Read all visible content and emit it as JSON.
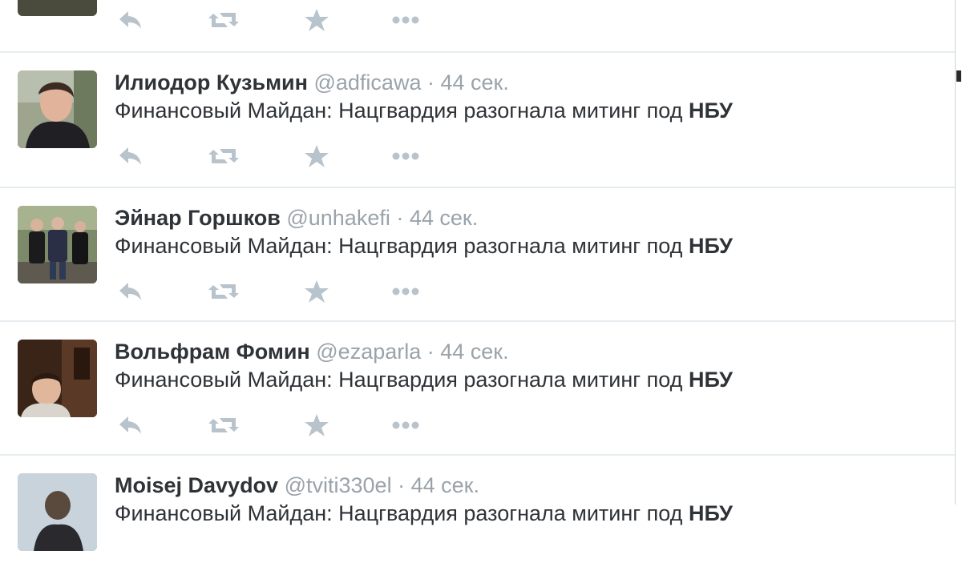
{
  "timeline": {
    "tweets": [
      {
        "author": "Илиодор Кузьмин",
        "handle": "@adficawa",
        "time": "· 44 сек.",
        "text": "Финансовый Майдан: Нацгвардия разогнала митинг под",
        "text_bold": "НБУ"
      },
      {
        "author": "Эйнар Горшков",
        "handle": "@unhakefi",
        "time": "· 44 сек.",
        "text": "Финансовый Майдан: Нацгвардия разогнала митинг под",
        "text_bold": "НБУ"
      },
      {
        "author": "Вольфрам Фомин",
        "handle": "@ezaparla",
        "time": "· 44 сек.",
        "text": "Финансовый Майдан: Нацгвардия разогнала митинг под",
        "text_bold": "НБУ"
      },
      {
        "author": "Moisej Davydov",
        "handle": "@tviti330el",
        "time": "· 44 сек.",
        "text": "Финансовый Майдан: Нацгвардия разогнала митинг под",
        "text_bold": "НБУ"
      }
    ],
    "action_icons": [
      "reply-icon",
      "retweet-icon",
      "favorite-icon",
      "more-icon"
    ]
  },
  "colors": {
    "author": "#2f3337",
    "meta": "#9aa3aa",
    "icon": "#b8c3cb",
    "divider": "#e6ecf0"
  }
}
